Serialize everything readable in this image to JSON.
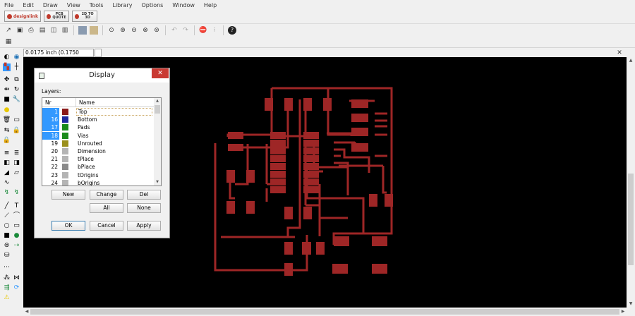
{
  "menu": [
    "File",
    "Edit",
    "Draw",
    "View",
    "Tools",
    "Library",
    "Options",
    "Window",
    "Help"
  ],
  "linkbar": [
    {
      "name": "designlink-button",
      "label": "designlink"
    },
    {
      "name": "pcb-quote-button",
      "label": "PCB QUOTE"
    },
    {
      "name": "3d-button",
      "label": "2D TO 3D"
    }
  ],
  "coordinates": {
    "value": "0.0175 inch (0.1750 1.5400)"
  },
  "dialog": {
    "title": "Display",
    "close_label": "✕",
    "layers_label": "Layers:",
    "columns": {
      "nr": "Nr",
      "name": "Name"
    },
    "layers": [
      {
        "nr": "1",
        "name": "Top",
        "color": "#8b1a1a",
        "selected": true,
        "focused": true
      },
      {
        "nr": "16",
        "name": "Bottom",
        "color": "#1f2a9e",
        "selected": true
      },
      {
        "nr": "17",
        "name": "Pads",
        "color": "#1a8a1a",
        "selected": true
      },
      {
        "nr": "18",
        "name": "Vias",
        "color": "#1a8a1a",
        "selected": true
      },
      {
        "nr": "19",
        "name": "Unrouted",
        "color": "#9a8f1c",
        "selected": false
      },
      {
        "nr": "20",
        "name": "Dimension",
        "color": "#b4b4b4",
        "selected": false
      },
      {
        "nr": "21",
        "name": "tPlace",
        "color": "#b4b4b4",
        "selected": false
      },
      {
        "nr": "22",
        "name": "bPlace",
        "color": "#8a8a8a",
        "selected": false
      },
      {
        "nr": "23",
        "name": "tOrigins",
        "color": "#b4b4b4",
        "selected": false
      },
      {
        "nr": "24",
        "name": "bOrigins",
        "color": "#b4b4b4",
        "selected": false
      }
    ],
    "buttons": {
      "new": "New",
      "change": "Change",
      "del": "Del",
      "all": "All",
      "none": "None",
      "ok": "OK",
      "cancel": "Cancel",
      "apply": "Apply"
    }
  },
  "colors": {
    "trace": "#9e2626",
    "canvas": "#000000"
  }
}
